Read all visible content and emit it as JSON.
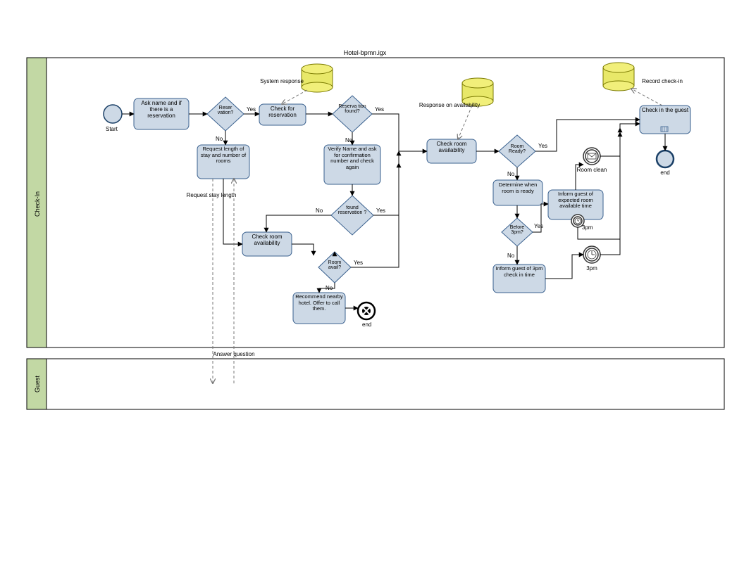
{
  "diagram_title": "Hotel-bpmn.igx",
  "lanes": {
    "checkin": "Check-In",
    "guest": "Guest"
  },
  "start_label": "Start",
  "tasks": {
    "ask_name": "Ask name and if there is a reservation",
    "check_res": "Check for reservation",
    "verify_name": "Verify Name and ask for confirmation number and check again",
    "request_stay": "Request length of stay and number of rooms",
    "check_room1": "Check room availability",
    "check_room2": "Check room availability",
    "recommend": "Recommend nearby hotel. Offer to call them.",
    "determine_ready": "Determine when room is ready",
    "inform_expected": "Inform guest of expected room available time",
    "inform_3pm": "Inform guest of 3pm check in time",
    "checkin_guest": "Check in the guest"
  },
  "gateways": {
    "reservation": "Reser vation?",
    "res_found": "Reserva tion found?",
    "found_res": "found reservation ?",
    "room_avail": "Room avail?",
    "room_ready": "Room Ready?",
    "before_3pm": "Before 3pm?"
  },
  "edge_labels": {
    "yes": "Yes",
    "no": "No"
  },
  "events": {
    "end1": "end",
    "end2": "end",
    "room_clean": "Room clean",
    "three_pm_timer": "3pm",
    "three_pm_boundary": "3pm"
  },
  "annotations": {
    "system_response": "System response",
    "resp_avail": "Response on availability",
    "record_checkin": "Record check-in",
    "req_stay_len": "Request stay length",
    "answer_q": "Answer question"
  },
  "chart_data": {
    "type": "bpmn-flowchart",
    "pools": [
      {
        "name": "Check-In"
      },
      {
        "name": "Guest"
      }
    ],
    "events": [
      {
        "id": "start",
        "type": "start",
        "label": "Start",
        "pool": "Check-In"
      },
      {
        "id": "end_term",
        "type": "terminate",
        "label": "end",
        "pool": "Check-In"
      },
      {
        "id": "end_final",
        "type": "end",
        "label": "end",
        "pool": "Check-In"
      },
      {
        "id": "msg_room_clean",
        "type": "intermediate-message",
        "label": "Room clean",
        "pool": "Check-In"
      },
      {
        "id": "timer_3pm",
        "type": "intermediate-timer",
        "label": "3pm",
        "pool": "Check-In"
      },
      {
        "id": "boundary_3pm",
        "type": "boundary-timer",
        "label": "3pm",
        "attached_to": "inform_expected",
        "pool": "Check-In"
      }
    ],
    "tasks": [
      {
        "id": "ask_name",
        "label": "Ask name and if there is a reservation",
        "pool": "Check-In"
      },
      {
        "id": "check_res",
        "label": "Check for reservation",
        "pool": "Check-In"
      },
      {
        "id": "verify_name",
        "label": "Verify Name and ask for confirmation number and check again",
        "pool": "Check-In"
      },
      {
        "id": "request_stay",
        "label": "Request length of stay and number of rooms",
        "pool": "Check-In"
      },
      {
        "id": "check_room1",
        "label": "Check room availability",
        "pool": "Check-In"
      },
      {
        "id": "check_room2",
        "label": "Check room availability",
        "pool": "Check-In"
      },
      {
        "id": "recommend",
        "label": "Recommend nearby hotel. Offer to call them.",
        "pool": "Check-In"
      },
      {
        "id": "determine_ready",
        "label": "Determine when room is ready",
        "pool": "Check-In"
      },
      {
        "id": "inform_expected",
        "label": "Inform guest of expected room available time",
        "pool": "Check-In"
      },
      {
        "id": "inform_3pm",
        "label": "Inform guest of 3pm check in time",
        "pool": "Check-In"
      },
      {
        "id": "checkin_guest",
        "label": "Check in the guest",
        "pool": "Check-In"
      }
    ],
    "gateways": [
      {
        "id": "gw_reservation",
        "label": "Reservation?",
        "pool": "Check-In"
      },
      {
        "id": "gw_res_found",
        "label": "Reservation found?",
        "pool": "Check-In"
      },
      {
        "id": "gw_found_res",
        "label": "found reservation?",
        "pool": "Check-In"
      },
      {
        "id": "gw_room_avail",
        "label": "Room avail?",
        "pool": "Check-In"
      },
      {
        "id": "gw_room_ready",
        "label": "Room Ready?",
        "pool": "Check-In"
      },
      {
        "id": "gw_before_3pm",
        "label": "Before 3pm?",
        "pool": "Check-In"
      }
    ],
    "data_stores": [
      {
        "id": "ds1",
        "near": "check_res",
        "label": "System response"
      },
      {
        "id": "ds2",
        "near": "check_room2",
        "label": "Response on availability"
      },
      {
        "id": "ds3",
        "near": "checkin_guest",
        "label": "Record check-in"
      }
    ],
    "sequence_flows": [
      {
        "from": "start",
        "to": "ask_name"
      },
      {
        "from": "ask_name",
        "to": "gw_reservation"
      },
      {
        "from": "gw_reservation",
        "to": "check_res",
        "label": "Yes"
      },
      {
        "from": "gw_reservation",
        "to": "request_stay",
        "label": "No"
      },
      {
        "from": "check_res",
        "to": "gw_res_found"
      },
      {
        "from": "gw_res_found",
        "to": "check_room2",
        "label": "Yes"
      },
      {
        "from": "gw_res_found",
        "to": "verify_name",
        "label": "No"
      },
      {
        "from": "verify_name",
        "to": "gw_found_res"
      },
      {
        "from": "gw_found_res",
        "to": "check_room2",
        "label": "Yes"
      },
      {
        "from": "gw_found_res",
        "to": "check_room1",
        "label": "No"
      },
      {
        "from": "request_stay",
        "to": "check_room1"
      },
      {
        "from": "check_room1",
        "to": "gw_room_avail"
      },
      {
        "from": "gw_room_avail",
        "to": "check_room2",
        "label": "Yes"
      },
      {
        "from": "gw_room_avail",
        "to": "recommend",
        "label": "No"
      },
      {
        "from": "recommend",
        "to": "end_term"
      },
      {
        "from": "check_room2",
        "to": "gw_room_ready"
      },
      {
        "from": "gw_room_ready",
        "to": "checkin_guest",
        "label": "Yes"
      },
      {
        "from": "gw_room_ready",
        "to": "determine_ready",
        "label": "No"
      },
      {
        "from": "determine_ready",
        "to": "gw_before_3pm"
      },
      {
        "from": "gw_before_3pm",
        "to": "inform_expected",
        "label": "Yes"
      },
      {
        "from": "gw_before_3pm",
        "to": "inform_3pm",
        "label": "No"
      },
      {
        "from": "inform_expected",
        "to": "msg_room_clean"
      },
      {
        "from": "msg_room_clean",
        "to": "checkin_guest"
      },
      {
        "from": "boundary_3pm",
        "to": "checkin_guest"
      },
      {
        "from": "inform_3pm",
        "to": "timer_3pm"
      },
      {
        "from": "timer_3pm",
        "to": "checkin_guest"
      },
      {
        "from": "checkin_guest",
        "to": "end_final"
      }
    ],
    "message_flows": [
      {
        "from": "ds1",
        "to": "check_res",
        "label": "System response"
      },
      {
        "from": "ds2",
        "to": "check_room2",
        "label": "Response on availability"
      },
      {
        "from": "checkin_guest",
        "to": "ds3",
        "label": "Record check-in"
      },
      {
        "from": "request_stay",
        "to": "Guest",
        "label": "Request stay length"
      },
      {
        "from": "Guest",
        "to": "request_stay",
        "label": "Answer question"
      }
    ]
  }
}
